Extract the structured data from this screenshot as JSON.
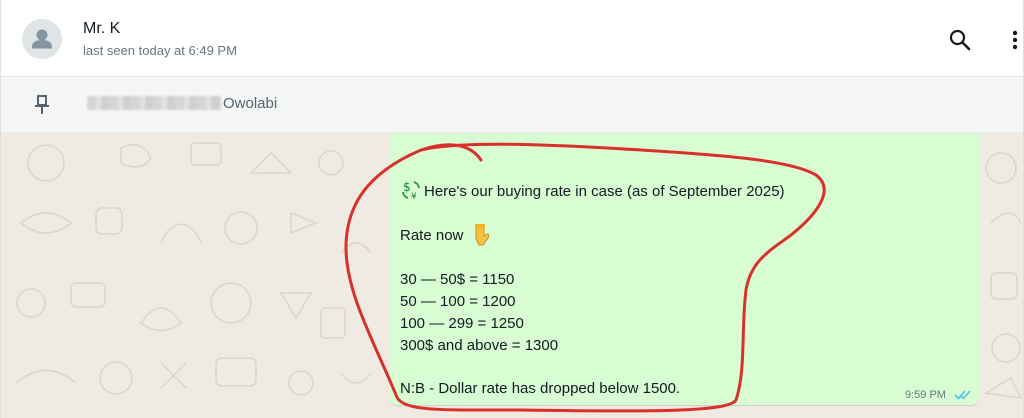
{
  "header": {
    "contact_name": "Mr. K",
    "status": "last seen today at 6:49 PM",
    "search_icon": "search-icon",
    "menu_icon": "kebab-menu-icon"
  },
  "pinned": {
    "icon": "pin-icon",
    "name_suffix": "Owolabi"
  },
  "message": {
    "intro": "Here's our buying rate in case (as of September 2025)",
    "rate_label": "Rate now",
    "rates": [
      "30 — 50$ = 1150",
      "50 — 100 = 1200",
      "100 — 299 = 1250",
      "300$ and above = 1300"
    ],
    "note": "N:B - Dollar rate has dropped below 1500.",
    "time": "9:59 PM",
    "read_ticks_color": "#53bdeb",
    "bubble_color": "#d9fdd3",
    "annotation_color": "#d8312b"
  }
}
